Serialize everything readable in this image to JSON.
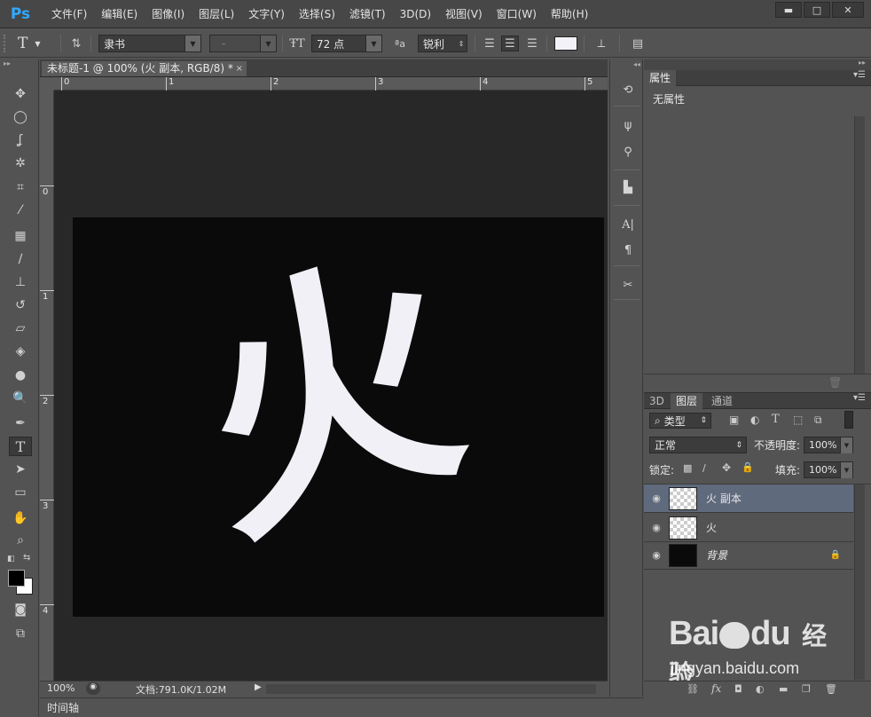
{
  "app": {
    "logo": "Ps"
  },
  "menu": [
    "文件(F)",
    "编辑(E)",
    "图像(I)",
    "图层(L)",
    "文字(Y)",
    "选择(S)",
    "滤镜(T)",
    "3D(D)",
    "视图(V)",
    "窗口(W)",
    "帮助(H)"
  ],
  "window_controls": {
    "minimize": "▬",
    "maximize": "□",
    "close": "✕"
  },
  "options": {
    "tool_glyph": "T",
    "font_family": "隶书",
    "font_style": "-",
    "font_size": "72 点",
    "antialias_label": "ªa",
    "antialias": "锐利",
    "text_color": "#f2f2f8"
  },
  "document": {
    "tab_title": "未标题-1 @ 100% (火 副本, RGB/8) *",
    "close": "×",
    "glyph": "火",
    "glyph_color": "#f0f0f6",
    "canvas_color": "#0a0a0a"
  },
  "ruler": {
    "h_labels": [
      "0",
      "1",
      "2",
      "3",
      "4",
      "5"
    ],
    "v_labels": [
      "0",
      "1",
      "2",
      "3",
      "4"
    ]
  },
  "status": {
    "zoom": "100%",
    "doc_info": "文档:791.0K/1.02M"
  },
  "timeline": {
    "label": "时间轴"
  },
  "properties": {
    "tab": "属性",
    "content": "无属性"
  },
  "layers_panel": {
    "tabs": [
      "3D",
      "图层",
      "通道"
    ],
    "filter_kind": "类型",
    "blend_mode": "正常",
    "opacity_label": "不透明度:",
    "opacity_value": "100%",
    "lock_label": "锁定:",
    "fill_label": "填充:",
    "fill_value": "100%",
    "layers": [
      {
        "name": "火 副本",
        "selected": true,
        "thumb": "checker"
      },
      {
        "name": "火",
        "selected": false,
        "thumb": "checker"
      },
      {
        "name": "背景",
        "selected": false,
        "thumb": "black",
        "locked": true
      }
    ]
  },
  "colors": {
    "foreground": "#000000",
    "background": "#ffffff",
    "accent": "#31a8ff"
  },
  "watermark": {
    "brand": "Bai",
    "brand2": "du",
    "cn": "经验",
    "url": "jingyan.baidu.com"
  }
}
